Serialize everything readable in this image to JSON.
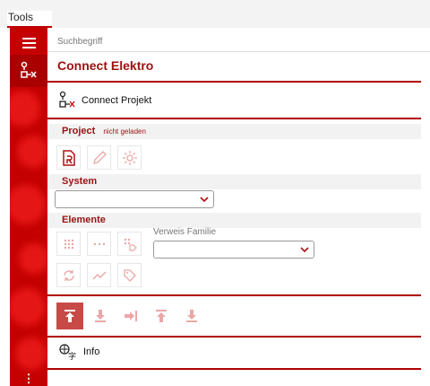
{
  "top_tab": {
    "label": "Tools"
  },
  "search": {
    "placeholder": "Suchbegriff"
  },
  "header": {
    "title": "Connect Elektro"
  },
  "connect_project": {
    "label": "Connect Projekt"
  },
  "project_section": {
    "title": "Project",
    "status": "nicht geladen"
  },
  "system_section": {
    "title": "System",
    "selected": ""
  },
  "elements_section": {
    "title": "Elemente",
    "ref_family_label": "Verweis Familie",
    "ref_family_selected": ""
  },
  "info": {
    "label": "Info"
  },
  "colors": {
    "accent": "#c50000",
    "title_red": "#9b1111",
    "primary_btn": "#c84a47"
  },
  "icons": {
    "rail": [
      "hamburger-menu-icon",
      "connect-icon",
      "more-options-icon"
    ],
    "project": [
      "project-document-icon",
      "edit-pencil-icon",
      "settings-gear-icon"
    ],
    "elements": [
      "dots-grid-icon",
      "dots-row-icon",
      "tag-dots-icon",
      "sync-icon",
      "route-icon",
      "tag-icon"
    ],
    "toolbar": [
      "upload-icon",
      "download-icon",
      "import-icon",
      "upload-all-icon",
      "download-all-icon"
    ],
    "info": "translate-icon"
  }
}
